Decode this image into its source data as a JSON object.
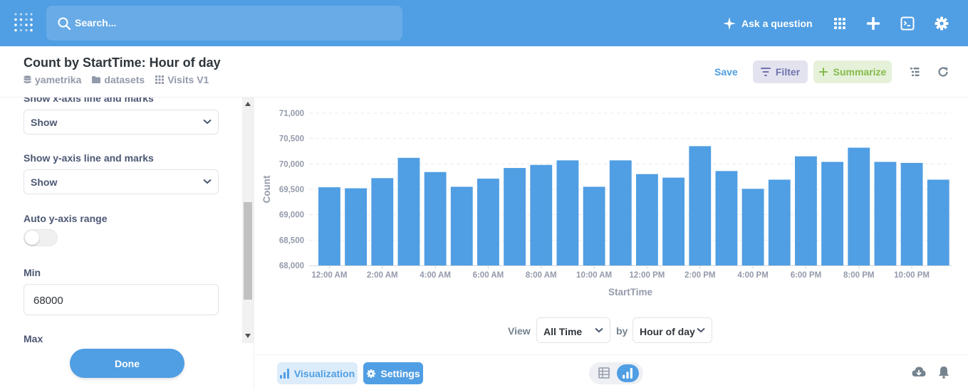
{
  "nav": {
    "search_placeholder": "Search...",
    "ask_label": "Ask a question",
    "brand_color": "#509ee3"
  },
  "header": {
    "title": "Count by StartTime: Hour of day",
    "breadcrumbs": [
      "yametrika",
      "datasets",
      "Visits V1"
    ],
    "save_label": "Save",
    "filter_label": "Filter",
    "summarize_label": "Summarize"
  },
  "sidebar": {
    "x_axis_label": "Show x-axis line and marks",
    "x_axis_value": "Show",
    "y_axis_label": "Show y-axis line and marks",
    "y_axis_value": "Show",
    "auto_range_label": "Auto y-axis range",
    "auto_range_on": false,
    "min_label": "Min",
    "min_value": "68000",
    "max_label": "Max",
    "done_label": "Done"
  },
  "view": {
    "view_label": "View",
    "period_value": "All Time",
    "by_label": "by",
    "grouping_value": "Hour of day"
  },
  "footer": {
    "visualization_label": "Visualization",
    "settings_label": "Settings"
  },
  "chart_data": {
    "type": "bar",
    "title": "",
    "xlabel": "StartTime",
    "ylabel": "Count",
    "ylim": [
      68000,
      71000
    ],
    "yticks": [
      "68,000",
      "68,500",
      "69,000",
      "69,500",
      "70,000",
      "70,500",
      "71,000"
    ],
    "xtick_labels": [
      "12:00 AM",
      "2:00 AM",
      "4:00 AM",
      "6:00 AM",
      "8:00 AM",
      "10:00 AM",
      "12:00 PM",
      "2:00 PM",
      "4:00 PM",
      "6:00 PM",
      "8:00 PM",
      "10:00 PM"
    ],
    "categories": [
      "12:00 AM",
      "1:00 AM",
      "2:00 AM",
      "3:00 AM",
      "4:00 AM",
      "5:00 AM",
      "6:00 AM",
      "7:00 AM",
      "8:00 AM",
      "9:00 AM",
      "10:00 AM",
      "11:00 AM",
      "12:00 PM",
      "1:00 PM",
      "2:00 PM",
      "3:00 PM",
      "4:00 PM",
      "5:00 PM",
      "6:00 PM",
      "7:00 PM",
      "8:00 PM",
      "9:00 PM",
      "10:00 PM",
      "11:00 PM"
    ],
    "values": [
      69540,
      69520,
      69720,
      70120,
      69840,
      69550,
      69710,
      69920,
      69980,
      70070,
      69550,
      70070,
      69800,
      69730,
      70350,
      69860,
      69510,
      69690,
      70150,
      70040,
      70320,
      70040,
      70020,
      69690
    ],
    "grid": true,
    "bar_color": "#509ee3"
  }
}
